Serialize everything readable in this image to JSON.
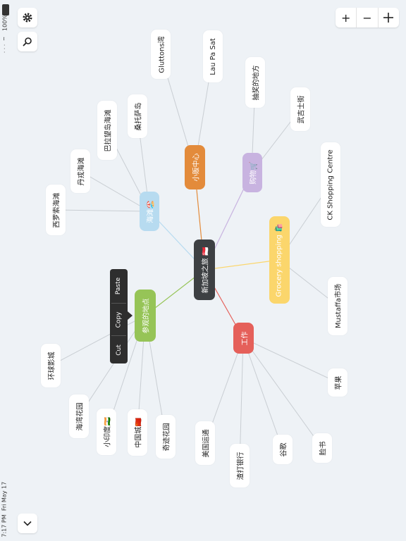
{
  "status": {
    "time": "7:17 PM",
    "date": "Fri May 17",
    "battery": "100%"
  },
  "toolbar": {
    "settings_icon": "gear-icon",
    "search_icon": "search-icon",
    "zoom_in": "+",
    "zoom_out": "−",
    "fit_icon": "crosshair-icon",
    "collapse_icon": "chevron-down-icon"
  },
  "mindmap": {
    "root": "新加坡之旅 🇸🇬",
    "branches": [
      {
        "id": "hawker",
        "label": "小贩中心",
        "color": "#e38b3b",
        "children": [
          "Gluttons湾",
          "Lau Pa Sat"
        ]
      },
      {
        "id": "shopping",
        "label": "购物🛒",
        "color": "#c8b3e0",
        "children": [
          "抽奖的地方",
          "武吉士街"
        ]
      },
      {
        "id": "grocery",
        "label": "Grocery shopping 🛍️",
        "color": "#fbd66c",
        "children": [
          "CK Shopping Centre",
          "Mustaffa市场"
        ]
      },
      {
        "id": "work",
        "label": "工作",
        "color": "#e5605a",
        "children": [
          "苹果",
          "脸书",
          "谷歌",
          "渣打银行",
          "美国运通"
        ]
      },
      {
        "id": "places",
        "label": "参观的地点",
        "color": "#96c457",
        "children": [
          "环球影城",
          "海湾花园",
          "小印度🇮🇳",
          "中国城🇨🇳",
          "奇迹花园"
        ]
      },
      {
        "id": "beach",
        "label": "海滩🏖️",
        "color": "#b7dbf0",
        "children": [
          "西罗索海滩",
          "丹戎海滩",
          "巴拉望岛海滩",
          "桑托萨岛"
        ]
      }
    ]
  },
  "context_menu": {
    "cut": "Cut",
    "copy": "Copy",
    "paste": "Paste"
  }
}
